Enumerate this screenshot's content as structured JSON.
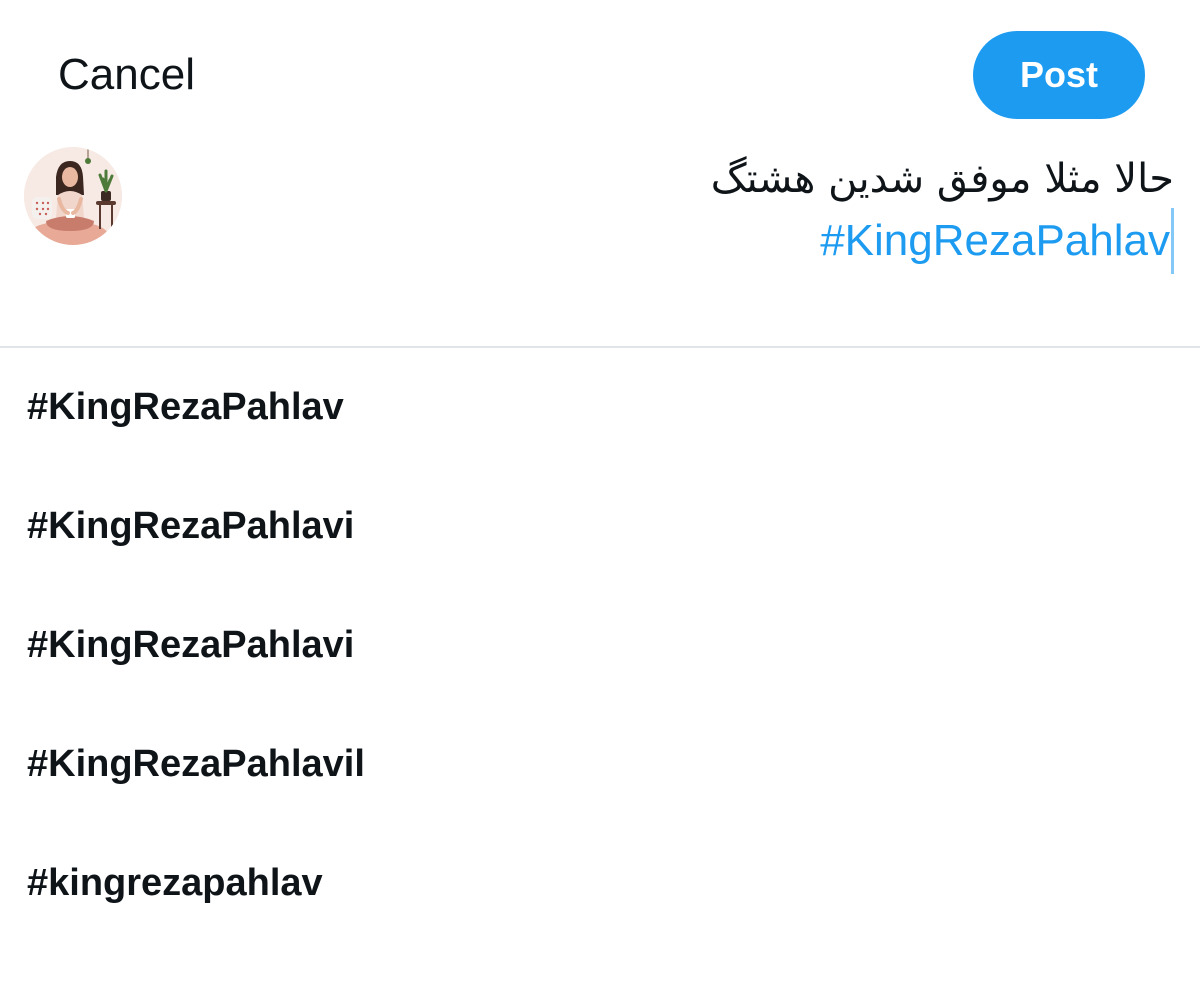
{
  "header": {
    "cancel_label": "Cancel",
    "post_label": "Post"
  },
  "composer": {
    "text_line": "حالا مثلا موفق شدین هشتگ",
    "hashtag_typed": "#KingRezaPahlav",
    "avatar_icon": "user-avatar-illustration"
  },
  "suggestions": [
    {
      "label": "#KingRezaPahlav"
    },
    {
      "label": "#KingRezaPahlavi"
    },
    {
      "label": "#KingRezaPahlavi"
    },
    {
      "label": "#KingRezaPahlavil"
    },
    {
      "label": "#kingrezapahlav"
    }
  ],
  "colors": {
    "accent": "#1d9bf0",
    "text": "#0f1419",
    "divider": "#e1e4e8"
  }
}
